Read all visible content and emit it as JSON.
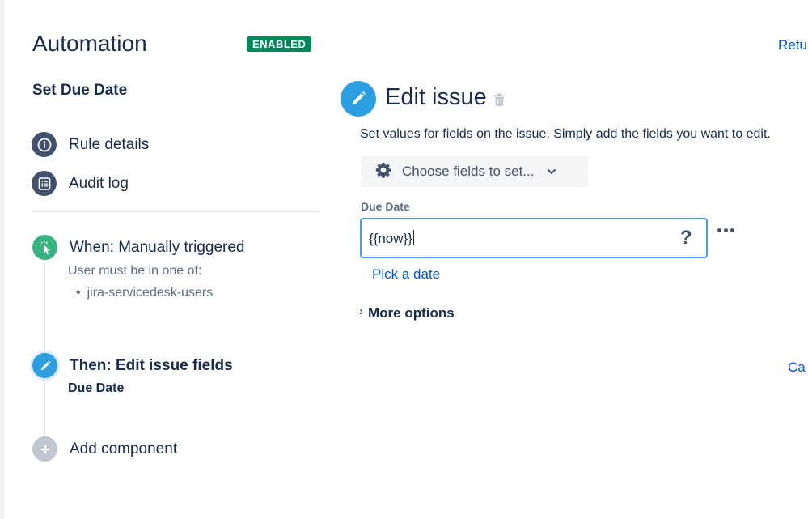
{
  "header": {
    "title": "Automation",
    "status_badge": "ENABLED",
    "return_link": "Retu"
  },
  "rule": {
    "name": "Set Due Date"
  },
  "nav": {
    "items": [
      {
        "label": "Rule details",
        "icon": "info-icon"
      },
      {
        "label": "Audit log",
        "icon": "list-icon"
      }
    ]
  },
  "flow": {
    "trigger": {
      "title": "When: Manually triggered",
      "subtitle": "User must be in one of:",
      "groups": [
        "jira-servicedesk-users"
      ]
    },
    "action": {
      "title": "Then: Edit issue fields",
      "detail": "Due Date"
    },
    "add_component": "Add component"
  },
  "editor": {
    "title": "Edit issue",
    "description": "Set values for fields on the issue. Simply add the fields you want to edit.",
    "choose_fields_label": "Choose fields to set...",
    "field": {
      "label": "Due Date",
      "value": "{{now}}",
      "help": "?"
    },
    "pick_date": "Pick a date",
    "more_options": "More options",
    "cancel_link": "Ca"
  },
  "colors": {
    "enabled_green": "#00875a",
    "link_blue": "#0052cc",
    "trigger_green": "#36b37e",
    "action_blue": "#2d9fe0",
    "nav_icon": "#42526e",
    "focus_border": "#4c9aff"
  }
}
